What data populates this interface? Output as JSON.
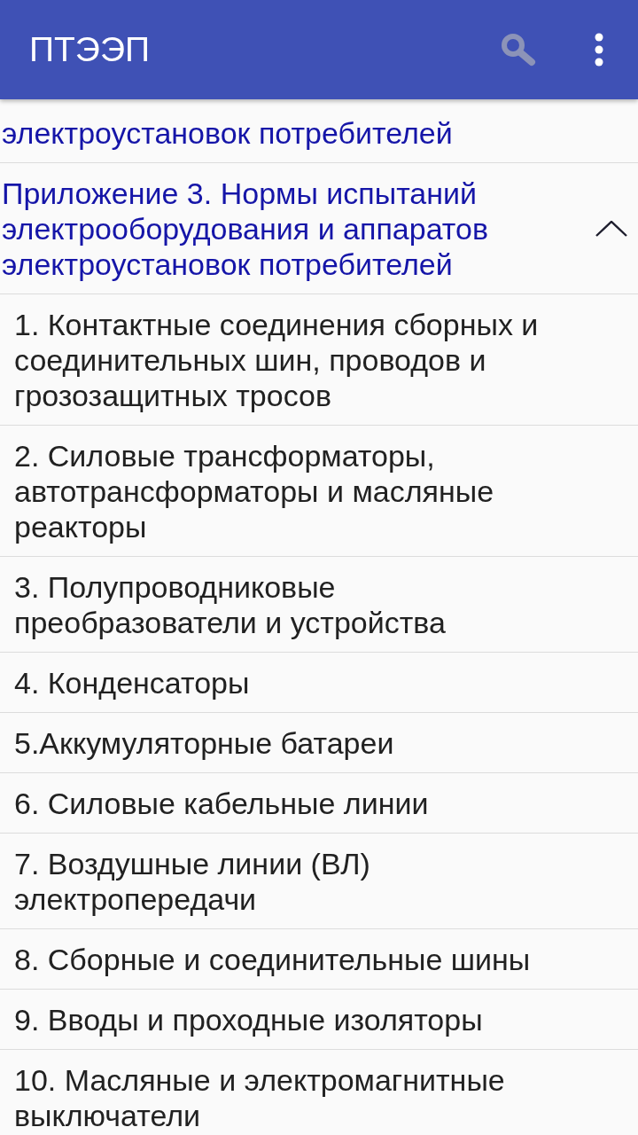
{
  "app_bar": {
    "title": "ПТЭЭП"
  },
  "list": {
    "cut_item": {
      "title": "электроустановок потребителей"
    },
    "group": {
      "title": "Приложение 3. Нормы испытаний электрооборудования и аппаратов электроустановок потребителей",
      "expanded": true,
      "children": [
        {
          "title": "1. Контактные соединения сборных и соединительных шин, проводов и грозозащитных тросов"
        },
        {
          "title": "2. Силовые трансформаторы, автотрансформаторы и масляные реакторы"
        },
        {
          "title": "3. Полупроводниковые преобразователи и устройства"
        },
        {
          "title": "4. Конденсаторы"
        },
        {
          "title": "5.Аккумуляторные батареи"
        },
        {
          "title": "6. Силовые кабельные линии"
        },
        {
          "title": "7. Воздушные линии (ВЛ) электропередачи"
        },
        {
          "title": "8. Сборные и соединительные шины"
        },
        {
          "title": "9. Вводы и проходные изоляторы"
        },
        {
          "title": "10. Масляные и электромагнитные выключатели"
        }
      ]
    }
  }
}
